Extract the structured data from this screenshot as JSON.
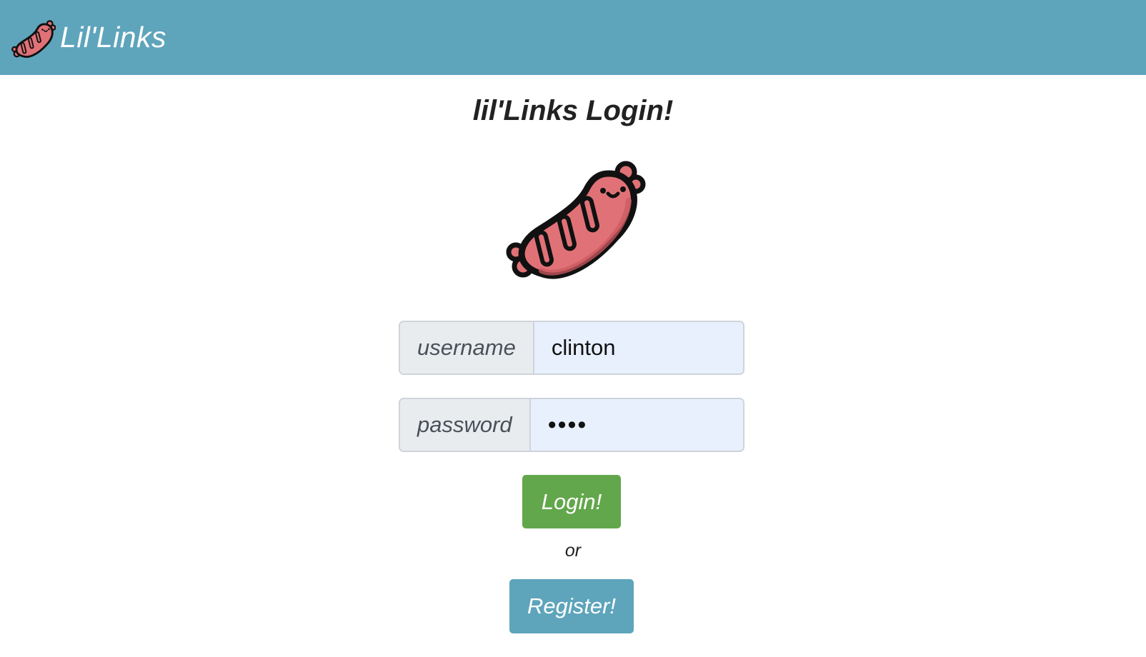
{
  "navbar": {
    "brand_text": "Lil'Links",
    "logo_icon": "sausage-icon",
    "background_color": "#5ea4bb"
  },
  "login": {
    "title": "lil'Links Login!",
    "hero_icon": "sausage-icon",
    "username": {
      "label": "username",
      "value": "clinton"
    },
    "password": {
      "label": "password",
      "value": "••••"
    },
    "login_button": "Login!",
    "or_text": "or",
    "register_button": "Register!"
  },
  "colors": {
    "accent": "#5ea4bb",
    "success": "#62a74b",
    "sausage": "#e07277",
    "input_autofill": "#e8f0fe"
  }
}
